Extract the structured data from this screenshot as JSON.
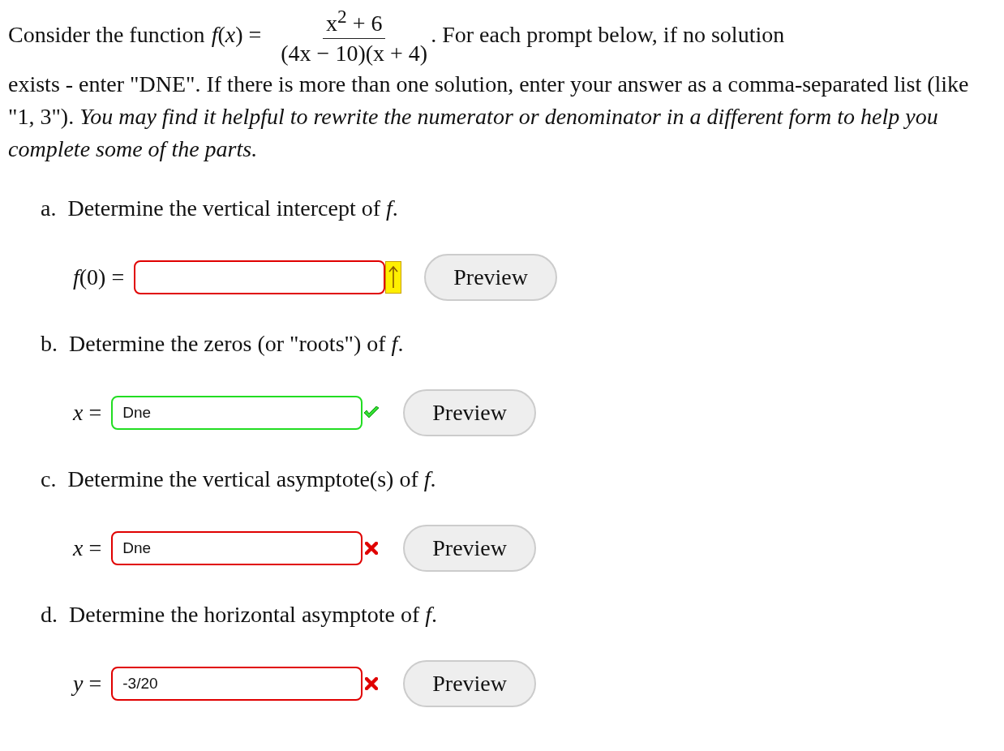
{
  "intro": {
    "lead": "Consider the function",
    "function_label": "*f*(*x*) =",
    "numerator": "x$^{2}$ + 6",
    "denominator": "(4x − 10)(x + 4)",
    "tail": ". For each prompt below, if no solution",
    "rest": "exists - enter \"DNE\". If there is more than one solution, enter your answer as a comma-separated list (like \"1, 3\"). *You may find it helpful to rewrite the numerator or denominator in a different form to help you complete some of the parts.*"
  },
  "parts": [
    {
      "label": "a.",
      "prompt": "Determine the vertical intercept of *f*.",
      "lhs": "*f*(0) =",
      "kind": "unanswered",
      "button": "Preview"
    },
    {
      "label": "b.",
      "prompt": "Determine the zeros (or \"roots\") of *f*.",
      "lhs": "*x* =",
      "value": "Dne",
      "kind": "correct",
      "button": "Preview"
    },
    {
      "label": "c.",
      "prompt": "Determine the vertical asymptote(s) of *f*.",
      "lhs": "*x* =",
      "value": "Dne",
      "kind": "incorrect",
      "button": "Preview"
    },
    {
      "label": "d.",
      "prompt": "Determine the horizontal asymptote of *f*.",
      "lhs": "*y* =",
      "value": "-3/20",
      "kind": "incorrect",
      "button": "Preview"
    }
  ]
}
